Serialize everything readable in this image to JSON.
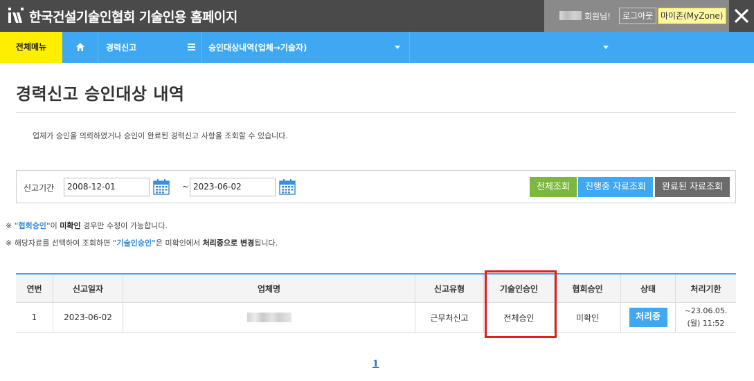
{
  "header": {
    "site_title": "한국건설기술인협회 기술인용 홈페이지",
    "user_greeting": "회원님!",
    "logout_label": "로그아웃",
    "myzone_label": "마이존(MyZone)"
  },
  "nav": {
    "all_menu": "전체메뉴",
    "career_report": "경력신고",
    "approval_list": "승인대상내역(업체→기술자)"
  },
  "page": {
    "title": "경력신고 승인대상 내역",
    "description": "업체가 승인을 의뢰하였거나 승인이 완료된 경력신고 사항을 조회할 수 있습니다."
  },
  "search": {
    "period_label": "신고기간",
    "start_date": "2008-12-01",
    "tilde": "~",
    "end_date": "2023-06-02",
    "btn_all": "전체조회",
    "btn_progress": "진행중 자료조회",
    "btn_done": "완료된 자료조회"
  },
  "notes": {
    "n1_mark": "※",
    "n1_a": "\"협회승인\"",
    "n1_b": "이",
    "n1_c": "미확인",
    "n1_d": "경우만 수정이 가능합니다.",
    "n2_mark": "※",
    "n2_a": "해당자료를 선택하여 조회하면",
    "n2_b": "\"기술인승인\"",
    "n2_c": "은 미확인에서",
    "n2_d": "처리중으로 변경",
    "n2_e": "됩니다."
  },
  "table": {
    "headers": [
      "연번",
      "신고일자",
      "업체명",
      "신고유형",
      "기술인승인",
      "협회승인",
      "상태",
      "처리기한"
    ],
    "rows": [
      {
        "no": "1",
        "date": "2023-06-02",
        "type": "근무처신고",
        "tech_approval": "전체승인",
        "assoc_approval": "미확인",
        "status": "처리중",
        "deadline_line1": "~23.06.05.",
        "deadline_line2": "(월) 11:52"
      }
    ]
  },
  "pagination": {
    "current": "1"
  },
  "colors": {
    "accent_blue": "#3ea8f2",
    "menu_yellow": "#ffee00",
    "header_gray": "#4a4a4a",
    "highlight_red": "#e01e1e"
  }
}
